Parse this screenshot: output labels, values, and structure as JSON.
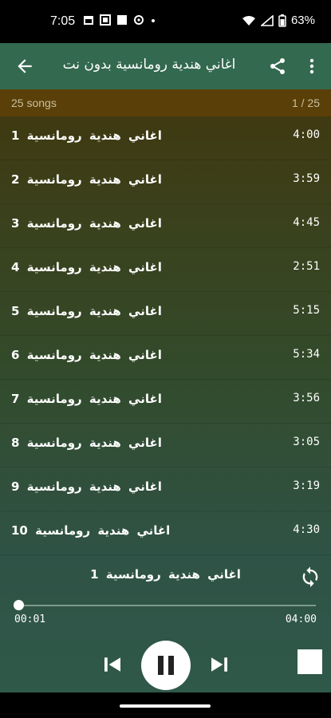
{
  "status_bar": {
    "time": "7:05",
    "battery": "63%"
  },
  "app_bar": {
    "title": "اغاني هندية رومانسية بدون نت"
  },
  "playlist": {
    "count_label": "25 songs",
    "position_label": "1 / 25"
  },
  "songs": [
    {
      "title": "اغاني هندية رومانسية 1",
      "duration": "4:00"
    },
    {
      "title": "اغاني هندية رومانسية 2",
      "duration": "3:59"
    },
    {
      "title": "اغاني هندية رومانسية 3",
      "duration": "4:45"
    },
    {
      "title": "اغاني هندية رومانسية 4",
      "duration": "2:51"
    },
    {
      "title": "اغاني هندية رومانسية 5",
      "duration": "5:15"
    },
    {
      "title": "اغاني هندية رومانسية 6",
      "duration": "5:34"
    },
    {
      "title": "اغاني هندية رومانسية 7",
      "duration": "3:56"
    },
    {
      "title": "اغاني هندية رومانسية 8",
      "duration": "3:05"
    },
    {
      "title": "اغاني هندية رومانسية 9",
      "duration": "3:19"
    },
    {
      "title": "اغاني هندية رومانسية 10",
      "duration": "4:30"
    }
  ],
  "player": {
    "now_playing": "اغاني هندية رومانسية 1",
    "current_time": "00:01",
    "total_time": "04:00",
    "progress": 0.004
  },
  "icons": {
    "back": "arrow-back-icon",
    "share": "share-icon",
    "more": "more-vert-icon",
    "repeat": "repeat-icon",
    "previous": "skip-previous-icon",
    "pause": "pause-icon",
    "next": "skip-next-icon",
    "stop": "stop-icon"
  },
  "colors": {
    "app_bar": "#33694f",
    "count_bar": "#5a3f08",
    "accent": "#ffffff"
  }
}
